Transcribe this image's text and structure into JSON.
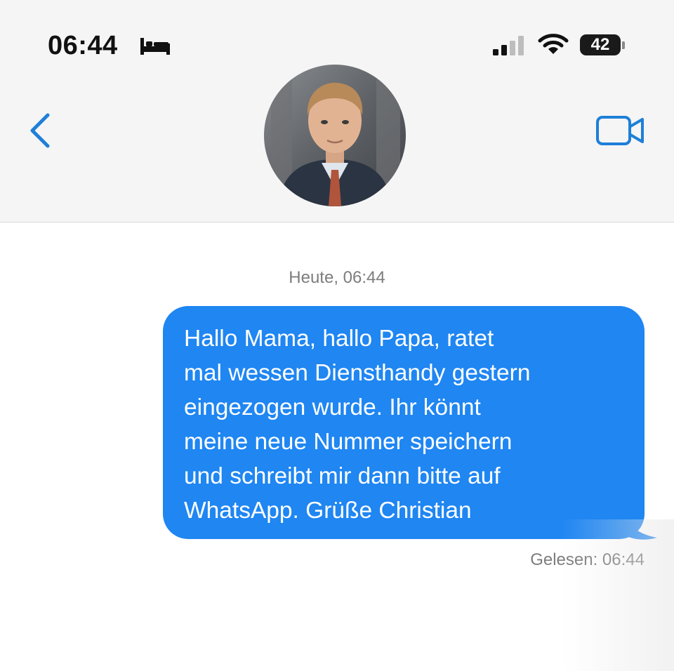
{
  "status_bar": {
    "time": "06:44",
    "sleep_icon": "bed-icon",
    "signal_icon": "cellular-signal-icon",
    "wifi_icon": "wifi-icon",
    "battery_level": "42"
  },
  "header": {
    "back_icon": "chevron-left-icon",
    "video_icon": "video-camera-icon",
    "avatar": "contact-avatar"
  },
  "conversation": {
    "date_label": "Heute, 06:44",
    "messages": [
      {
        "direction": "outgoing",
        "text": "Hallo Mama, hallo Papa, ratet\nmal wessen Diensthandy gestern\neingezogen wurde. Ihr könnt\nmeine neue Nummer speichern\nund schreibt mir dann bitte auf\nWhatsApp. Grüße Christian"
      }
    ],
    "read_receipt": "Gelesen: 06:44"
  },
  "colors": {
    "bubble_blue": "#1f86f2",
    "ios_blue": "#1e7fd8",
    "header_bg": "#f5f5f5",
    "meta_gray": "#7d7d7d"
  }
}
